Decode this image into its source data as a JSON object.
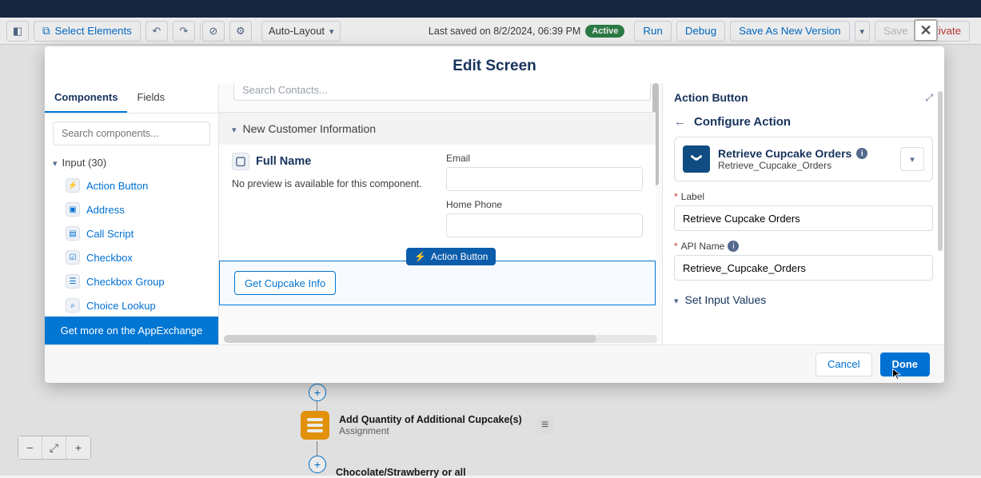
{
  "toolbar": {
    "select_elements": "Select Elements",
    "auto_layout": "Auto-Layout",
    "last_saved": "Last saved on 8/2/2024, 06:39 PM",
    "status": "Active",
    "run": "Run",
    "debug": "Debug",
    "save_as_new": "Save As New Version",
    "save": "Save",
    "activate": "ctivate"
  },
  "canvas_behind": {
    "node1_title": "Add Quantity of Additional Cupcake(s)",
    "node1_sub": "Assignment",
    "node2_title": "Chocolate/Strawberry or all"
  },
  "modal": {
    "title": "Edit Screen",
    "cancel": "Cancel",
    "done": "Done"
  },
  "left_panel": {
    "tab_components": "Components",
    "tab_fields": "Fields",
    "search_placeholder": "Search components...",
    "group": "Input (30)",
    "items": [
      "Action Button",
      "Address",
      "Call Script",
      "Checkbox",
      "Checkbox Group",
      "Choice Lookup"
    ],
    "appexchange": "Get more on the AppExchange"
  },
  "center": {
    "search_contacts": "Search Contacts...",
    "section_title": "New Customer Information",
    "full_name": "Full Name",
    "no_preview": "No preview is available for this component.",
    "email_label": "Email",
    "phone_label": "Home Phone",
    "chip_label": "Action Button",
    "drop_btn": "Get Cupcake Info"
  },
  "right_panel": {
    "title": "Action Button",
    "sub_title": "Configure Action",
    "card_title": "Retrieve Cupcake Orders",
    "card_api": "Retrieve_Cupcake_Orders",
    "label_lbl": "Label",
    "label_val": "Retrieve Cupcake Orders",
    "api_lbl": "API Name",
    "api_val": "Retrieve_Cupcake_Orders",
    "collapse": "Set Input Values"
  }
}
